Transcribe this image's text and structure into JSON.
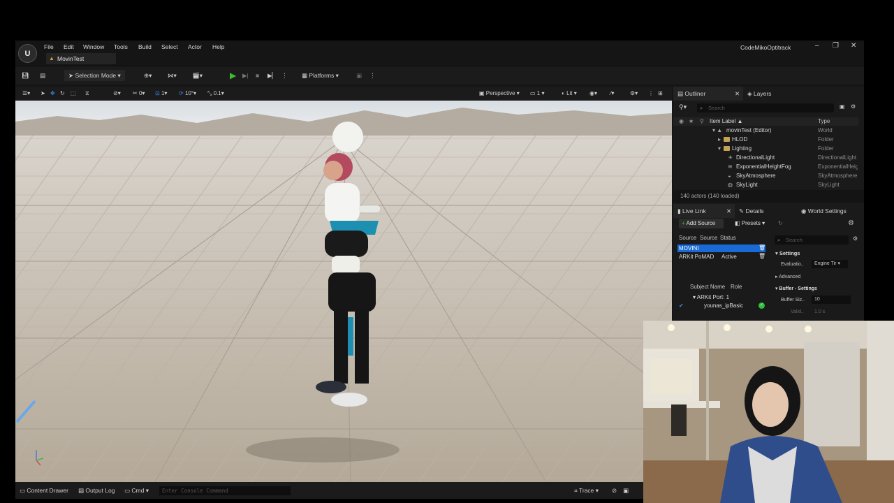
{
  "app": {
    "project_name": "CodeMikoOptitrack",
    "document_tab": "MovinTest",
    "logo_text": "U",
    "window_controls": [
      "–",
      "❐",
      "✕"
    ]
  },
  "menu": [
    "File",
    "Edit",
    "Window",
    "Tools",
    "Build",
    "Select",
    "Actor",
    "Help"
  ],
  "toolbar": {
    "selection_mode": "Selection Mode",
    "platforms": "Platforms"
  },
  "viewport_toolbar": {
    "rotation_snap": "0",
    "translate_snap": "1",
    "angle_snap": "10°",
    "scale_snap": "0.1",
    "perspective": "Perspective",
    "camera_speed": "1",
    "lit": "Lit"
  },
  "outliner": {
    "tab_outliner": "Outliner",
    "tab_layers": "Layers",
    "search_placeholder": "Search",
    "col_label": "Item Label ▲",
    "col_type": "Type",
    "rows": [
      {
        "label": "movinTest (Editor)",
        "type": "World"
      },
      {
        "label": "HLOD",
        "type": "Folder"
      },
      {
        "label": "Lighting",
        "type": "Folder"
      },
      {
        "label": "DirectionalLight",
        "type": "DirectionalLight"
      },
      {
        "label": "ExponentialHeightFog",
        "type": "ExponentialHeightFog"
      },
      {
        "label": "SkyAtmosphere",
        "type": "SkyAtmosphere"
      },
      {
        "label": "SkyLight",
        "type": "SkyLight"
      }
    ],
    "status": "140 actors (140 loaded)"
  },
  "livelink": {
    "tab_livelink": "Live Link",
    "tab_details": "Details",
    "tab_world": "World Settings",
    "add_source": "Add Source",
    "presets": "Presets",
    "col_source1": "Source",
    "col_source2": "Source",
    "col_status": "Status",
    "sources": [
      {
        "name": "MOVINI",
        "status": ""
      },
      {
        "name": "ARKit PoMAD",
        "status": "Active"
      }
    ],
    "col_subject": "Subject Name",
    "col_role": "Role",
    "subject_group": "ARKit Port: 1",
    "subject": "younas_ipBasic"
  },
  "details": {
    "search_placeholder": "Search",
    "section_settings": "Settings",
    "evaluation_label": "Evaluatio..",
    "evaluation_value": "Engine Tir",
    "advanced": "Advanced",
    "section_buffer": "Buffer - Settings",
    "buffer_size_label": "Buffer Siz..",
    "buffer_size_value": "10",
    "valid_label": "Valid..",
    "valid_value": "1.0 s"
  },
  "statusbar": {
    "content_drawer": "Content Drawer",
    "output_log": "Output Log",
    "cmd": "Cmd",
    "console_placeholder": "Enter Console Command",
    "trace": "Trace"
  },
  "colors": {
    "accent_blue": "#1a6ad6",
    "play_green": "#3dbb2c",
    "folder": "#c6a257"
  }
}
